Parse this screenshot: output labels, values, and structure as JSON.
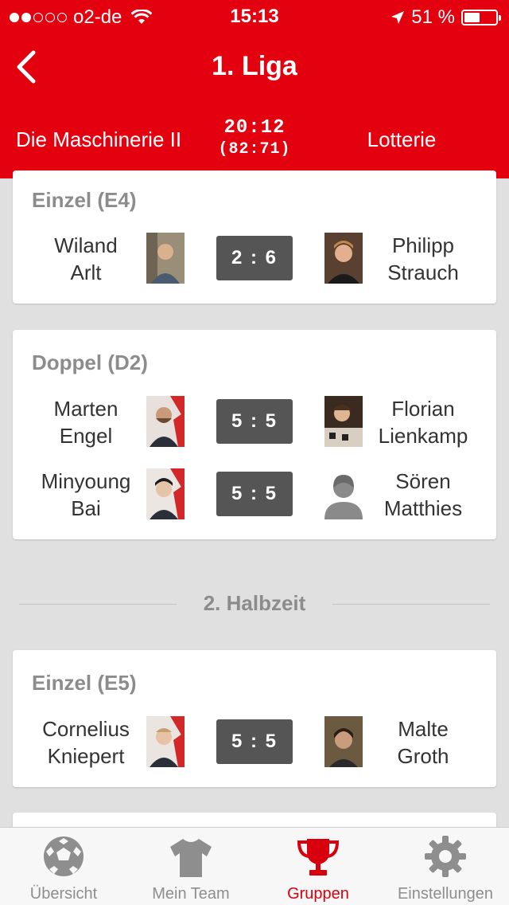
{
  "status_bar": {
    "carrier": "o2-de",
    "time": "15:13",
    "battery": "51 %",
    "battery_level": 0.51
  },
  "header": {
    "title": "1. Liga"
  },
  "match": {
    "home": "Die Maschinerie II",
    "away": "Lotterie",
    "score": "20:12",
    "half_score": "(82:71)"
  },
  "games": [
    {
      "title": "Einzel (E4)",
      "rows": [
        {
          "home": [
            "Wiland",
            "Arlt"
          ],
          "away": [
            "Philipp",
            "Strauch"
          ],
          "score": "2 : 6"
        }
      ]
    },
    {
      "title": "Doppel (D2)",
      "rows": [
        {
          "home": [
            "Marten",
            "Engel"
          ],
          "away": [
            "Florian",
            "Lienkamp"
          ],
          "score": "5 : 5"
        },
        {
          "home": [
            "Minyoung",
            "Bai"
          ],
          "away": [
            "Sören",
            "Matthies"
          ],
          "score": "5 : 5"
        }
      ]
    },
    {
      "title": "Einzel (E5)",
      "rows": [
        {
          "home": [
            "Cornelius",
            "Kniepert"
          ],
          "away": [
            "Malte",
            "Groth"
          ],
          "score": "5 : 5"
        }
      ]
    }
  ],
  "section_divider": "2. Halbzeit",
  "tabs": [
    {
      "label": "Übersicht",
      "icon": "soccer-ball-icon"
    },
    {
      "label": "Mein Team",
      "icon": "shirt-icon"
    },
    {
      "label": "Gruppen",
      "icon": "trophy-icon",
      "active": true
    },
    {
      "label": "Einstellungen",
      "icon": "gear-icon"
    }
  ],
  "colors": {
    "brand": "#e3000f",
    "tab_active": "#d9000d",
    "score_box": "#555555"
  }
}
